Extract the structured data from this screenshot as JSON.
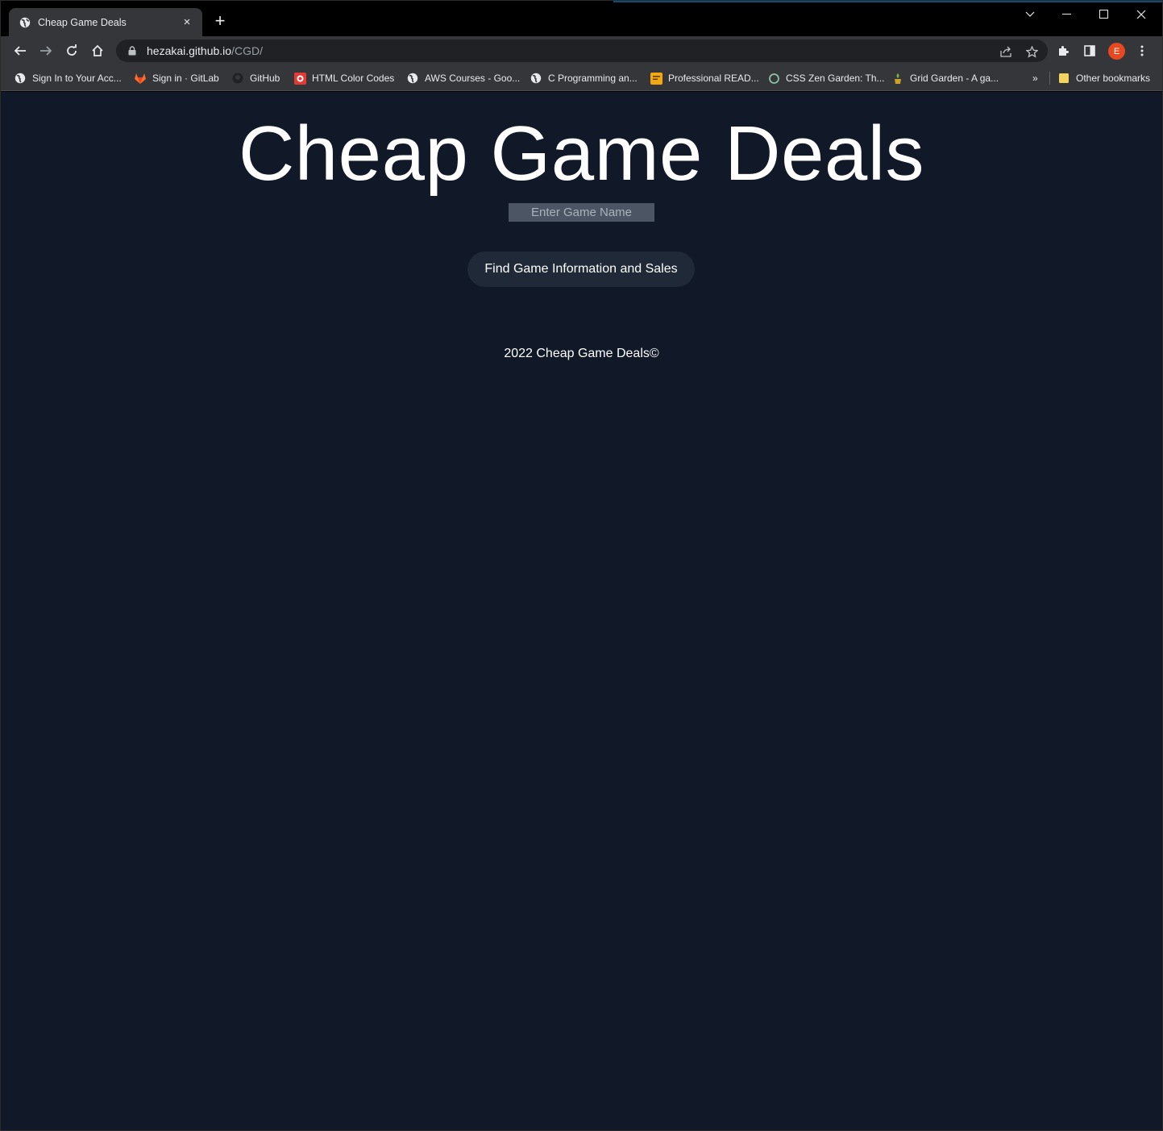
{
  "browser": {
    "tab": {
      "title": "Cheap Game Deals",
      "close_glyph": "×"
    },
    "new_tab_glyph": "+",
    "window_controls": [
      "chevron-down-icon",
      "minimize-icon",
      "maximize-icon",
      "close-icon"
    ],
    "url": {
      "host": "hezakai.github.io",
      "path": "/CGD/"
    },
    "profile_initial": "E",
    "profile_color": "#e8481f",
    "bookmarks": [
      {
        "label": "Sign In to Your Acc...",
        "icon": "globe-icon"
      },
      {
        "label": "Sign in · GitLab",
        "icon": "gitlab-icon"
      },
      {
        "label": "GitHub",
        "icon": "github-icon"
      },
      {
        "label": "HTML Color Codes",
        "icon": "html-color-icon"
      },
      {
        "label": "AWS Courses - Goo...",
        "icon": "globe-icon"
      },
      {
        "label": "C Programming an...",
        "icon": "globe-icon"
      },
      {
        "label": "Professional READ...",
        "icon": "readme-icon"
      },
      {
        "label": "CSS Zen Garden: Th...",
        "icon": "zen-garden-icon"
      },
      {
        "label": "Grid Garden - A ga...",
        "icon": "grid-garden-icon"
      }
    ],
    "bookmarks_overflow_glyph": "»",
    "other_bookmarks": "Other bookmarks"
  },
  "page": {
    "background": "#111828",
    "title": "Cheap Game Deals",
    "search": {
      "placeholder": "Enter Game Name",
      "value": ""
    },
    "find_button": "Find Game Information and Sales",
    "footer": "2022 Cheap Game Deals©"
  }
}
